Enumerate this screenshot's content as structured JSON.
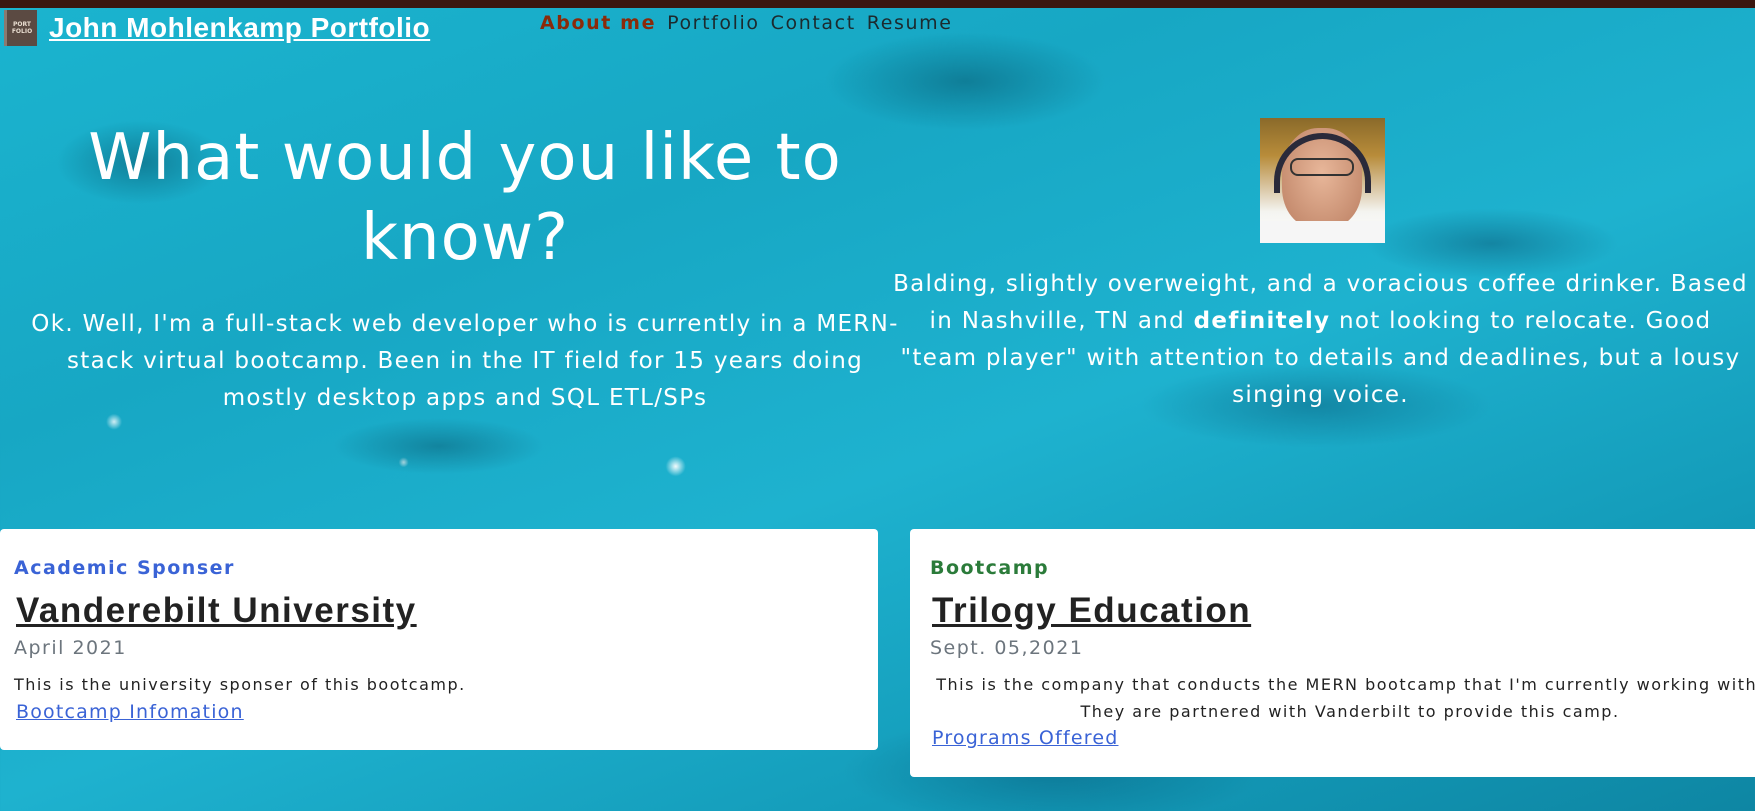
{
  "header": {
    "logo_text": [
      "PORT",
      "FOLIO"
    ],
    "title": "John Mohlenkamp Portfolio"
  },
  "nav": {
    "items": [
      {
        "label": "About me",
        "active": true
      },
      {
        "label": "Portfolio"
      },
      {
        "label": "Contact"
      },
      {
        "label": "Resume"
      }
    ]
  },
  "hero": {
    "title": "What would you like to know?",
    "intro": "Ok. Well, I'm a full-stack web developer who is currently in a MERN-stack virtual bootcamp. Been in the IT field for 15 years doing mostly desktop apps and SQL ETL/SPs",
    "bio_before": "Balding, slightly overweight, and a voracious coffee drinker. Based in Nashville, TN and ",
    "bio_bold": "definitely",
    "bio_after": " not looking to relocate. Good \"team player\" with attention to details and deadlines, but a lousy singing voice."
  },
  "cards": [
    {
      "tag": "Academic Sponser",
      "title": "Vanderebilt University",
      "date": "April 2021",
      "body": "This is the university sponser of this bootcamp.",
      "link": "Bootcamp Infomation"
    },
    {
      "tag": "Bootcamp",
      "title": "Trilogy Education",
      "date": "Sept. 05,2021",
      "body": "This is the company that conducts the MERN bootcamp that I'm currently working with. They are partnered with Vanderbilt to provide this camp.",
      "link": "Programs Offered"
    }
  ],
  "colors": {
    "nav_active": "#8b2a0a",
    "academic_tag": "#3a63d6",
    "bootcamp_tag": "#2b7b3a",
    "link": "#3a63d6"
  }
}
